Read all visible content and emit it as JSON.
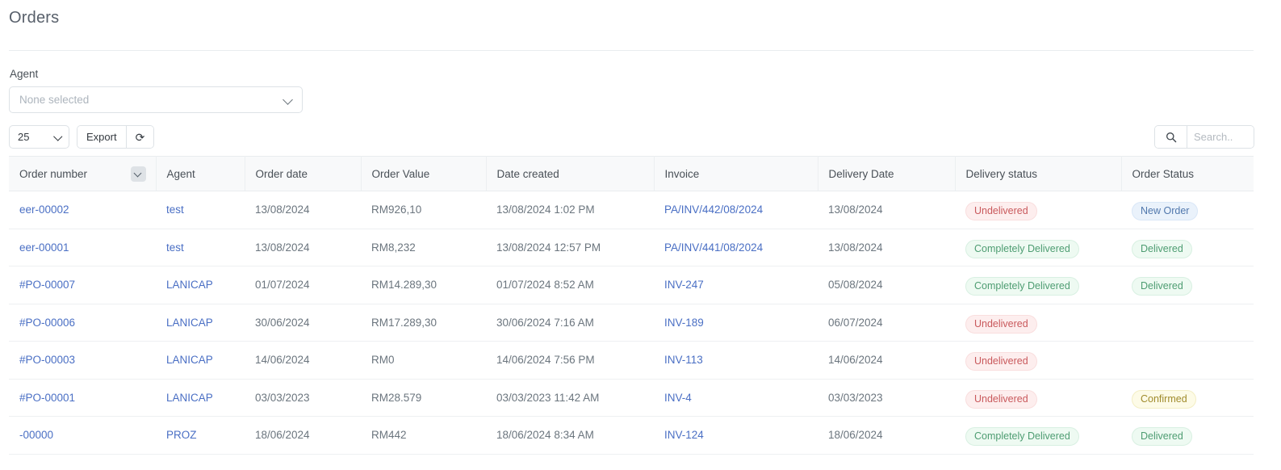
{
  "header": {
    "title": "Orders"
  },
  "filters": {
    "agent_label": "Agent",
    "agent_placeholder": "None selected",
    "agent_chevron_icon": "chevron-down-icon"
  },
  "toolbar": {
    "page_length": "25",
    "page_length_chevron_icon": "chevron-down-icon",
    "export_label": "Export",
    "refresh_icon": "refresh-icon",
    "refresh_glyph": "⟳"
  },
  "search": {
    "icon": "search-icon",
    "placeholder": "Search..",
    "value": ""
  },
  "table": {
    "sort_icon": "chevron-down-icon",
    "columns": [
      {
        "key": "order_number",
        "label": "Order number"
      },
      {
        "key": "agent",
        "label": "Agent"
      },
      {
        "key": "order_date",
        "label": "Order date"
      },
      {
        "key": "order_value",
        "label": "Order Value"
      },
      {
        "key": "date_created",
        "label": "Date created"
      },
      {
        "key": "invoice",
        "label": "Invoice"
      },
      {
        "key": "delivery_date",
        "label": "Delivery Date"
      },
      {
        "key": "delivery_status",
        "label": "Delivery status"
      },
      {
        "key": "order_status",
        "label": "Order Status"
      }
    ],
    "rows": [
      {
        "order_number": "eer-00002",
        "agent": "test",
        "order_date": "13/08/2024",
        "order_value": "RM926,10",
        "date_created": "13/08/2024 1:02 PM",
        "invoice": "PA/INV/442/08/2024",
        "delivery_date": "13/08/2024",
        "delivery_status": "Undelivered",
        "delivery_status_color": "red",
        "order_status": "New Order",
        "order_status_color": "blue"
      },
      {
        "order_number": "eer-00001",
        "agent": "test",
        "order_date": "13/08/2024",
        "order_value": "RM8,232",
        "date_created": "13/08/2024 12:57 PM",
        "invoice": "PA/INV/441/08/2024",
        "delivery_date": "13/08/2024",
        "delivery_status": "Completely Delivered",
        "delivery_status_color": "green",
        "order_status": "Delivered",
        "order_status_color": "green"
      },
      {
        "order_number": "#PO-00007",
        "agent": "LANICAP",
        "order_date": "01/07/2024",
        "order_value": "RM14.289,30",
        "date_created": "01/07/2024 8:52 AM",
        "invoice": "INV-247",
        "delivery_date": "05/08/2024",
        "delivery_status": "Completely Delivered",
        "delivery_status_color": "green",
        "order_status": "Delivered",
        "order_status_color": "green"
      },
      {
        "order_number": "#PO-00006",
        "agent": "LANICAP",
        "order_date": "30/06/2024",
        "order_value": "RM17.289,30",
        "date_created": "30/06/2024 7:16 AM",
        "invoice": "INV-189",
        "delivery_date": "06/07/2024",
        "delivery_status": "Undelivered",
        "delivery_status_color": "red",
        "order_status": "",
        "order_status_color": ""
      },
      {
        "order_number": "#PO-00003",
        "agent": "LANICAP",
        "order_date": "14/06/2024",
        "order_value": "RM0",
        "date_created": "14/06/2024 7:56 PM",
        "invoice": "INV-113",
        "delivery_date": "14/06/2024",
        "delivery_status": "Undelivered",
        "delivery_status_color": "red",
        "order_status": "",
        "order_status_color": ""
      },
      {
        "order_number": "#PO-00001",
        "agent": "LANICAP",
        "order_date": "03/03/2023",
        "order_value": "RM28.579",
        "date_created": "03/03/2023 11:42 AM",
        "invoice": "INV-4",
        "delivery_date": "03/03/2023",
        "delivery_status": "Undelivered",
        "delivery_status_color": "red",
        "order_status": "Confirmed",
        "order_status_color": "yellow"
      },
      {
        "order_number": "-00000",
        "agent": "PROZ",
        "order_date": "18/06/2024",
        "order_value": "RM442",
        "date_created": "18/06/2024 8:34 AM",
        "invoice": "INV-124",
        "delivery_date": "18/06/2024",
        "delivery_status": "Completely Delivered",
        "delivery_status_color": "green",
        "order_status": "Delivered",
        "order_status_color": "green"
      }
    ]
  },
  "colors": {
    "link": "#4a6fc4",
    "text": "#6b757e",
    "header_bg": "#f8f9fa",
    "border": "#e9ecef",
    "badge_red": "#c9595c",
    "badge_green": "#4e9d72",
    "badge_blue": "#5178ad",
    "badge_yellow": "#a08b2c"
  }
}
